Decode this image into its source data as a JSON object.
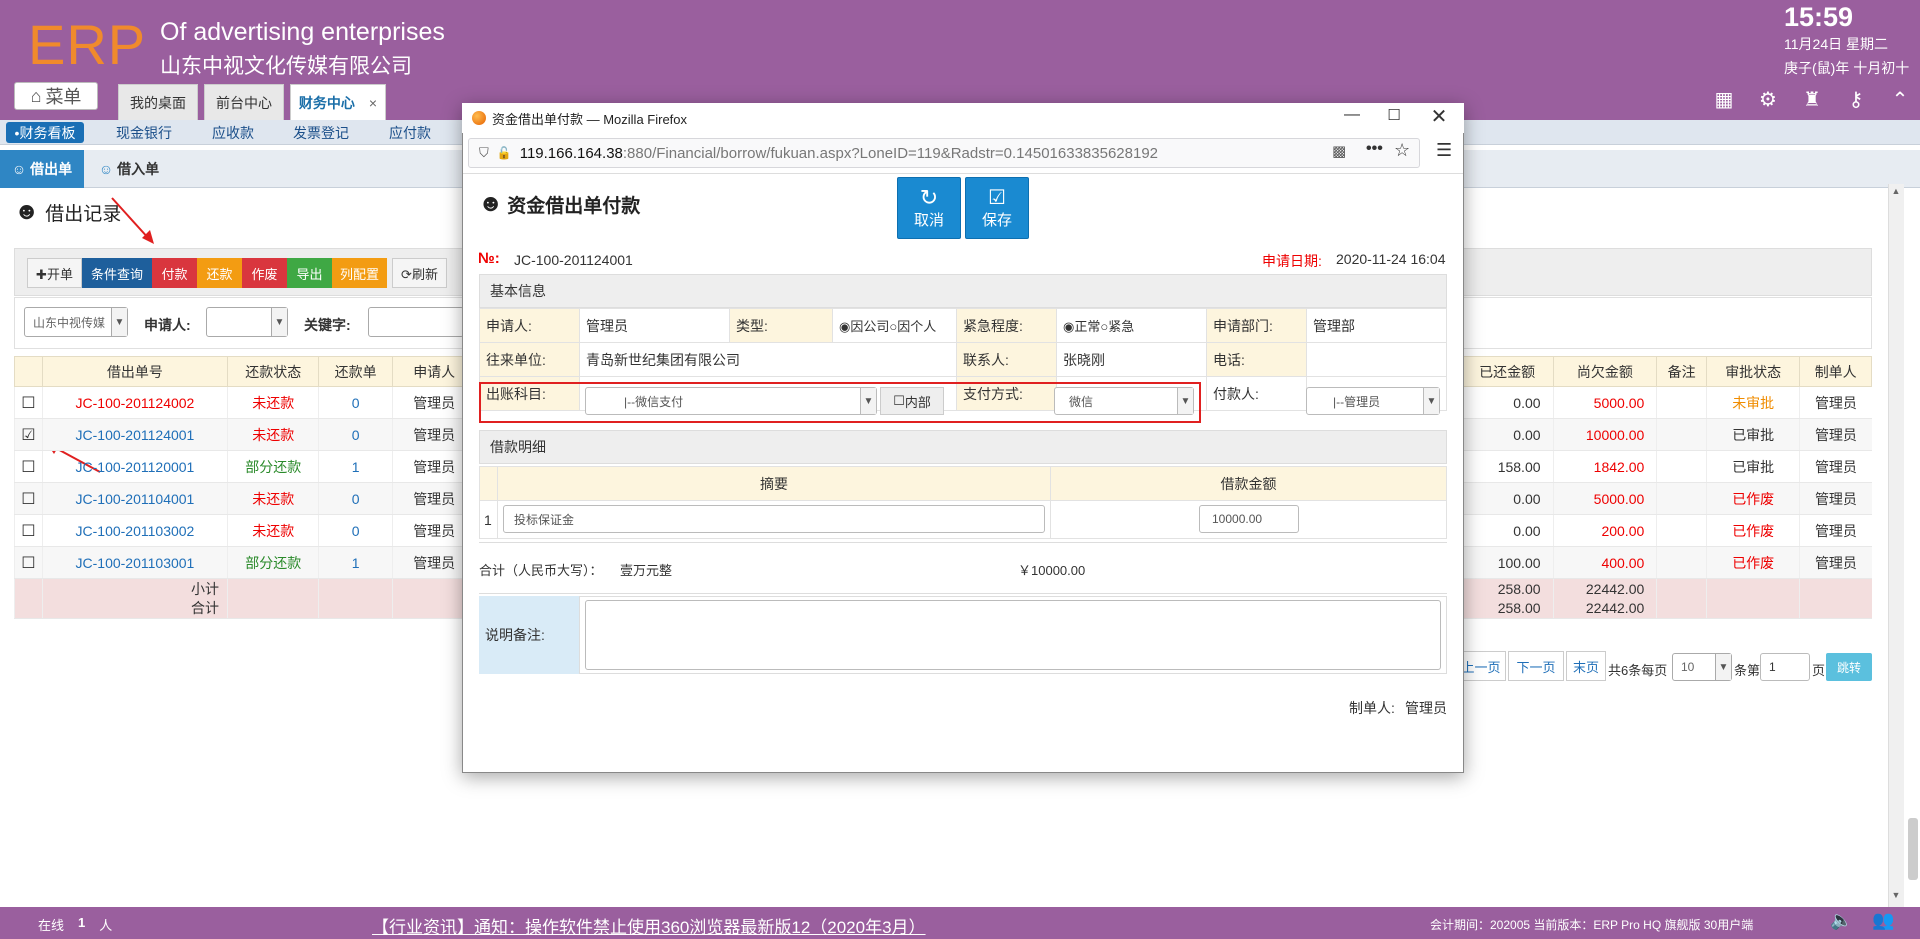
{
  "header": {
    "logo": "ERP",
    "company_en": "Of advertising enterprises",
    "company_cn": "山东中视文化传媒有限公司",
    "time": "15:59",
    "date": "11月24日 星期二",
    "lunar": "庚子(鼠)年 十月初十",
    "menu_label": "菜单",
    "tabs": [
      {
        "label": "我的桌面"
      },
      {
        "label": "前台中心"
      },
      {
        "label": "财务中心"
      }
    ],
    "tab_close": "×"
  },
  "subnav": [
    "•财务看板",
    "现金银行",
    "应收款",
    "发票登记",
    "应付款"
  ],
  "subtabs": [
    "借出单",
    "借入单"
  ],
  "page": {
    "title": "借出记录",
    "toolbar": [
      {
        "label": "✚开单",
        "color": "#f0f0f0"
      },
      {
        "label": "条件查询",
        "color": "#1e5f9c"
      },
      {
        "label": "付款",
        "color": "#d9363e"
      },
      {
        "label": "还款",
        "color": "#f39c12"
      },
      {
        "label": "作废",
        "color": "#d9363e"
      },
      {
        "label": "导出",
        "color": "#3fa844"
      },
      {
        "label": "列配置",
        "color": "#f39c12"
      },
      {
        "label": "⟳刷新",
        "color": "#f0f0f0"
      }
    ],
    "filter": {
      "company": "山东中视传媒",
      "applicant_label": "申请人:",
      "keyword_label": "关键字:"
    }
  },
  "table": {
    "headers": [
      "",
      "借出单号",
      "还款状态",
      "还款单",
      "申请人",
      "已还金额",
      "尚欠金额",
      "备注",
      "审批状态",
      "制单人"
    ],
    "rows": [
      {
        "checked": false,
        "no": "JC-100-201124002",
        "status": "未还款",
        "repay": "0",
        "applicant": "管理员",
        "paid": "0.00",
        "owed": "5000.00",
        "note": "",
        "approval": "未审批",
        "maker": "管理员"
      },
      {
        "checked": true,
        "no": "JC-100-201124001",
        "status": "未还款",
        "repay": "0",
        "applicant": "管理员",
        "paid": "0.00",
        "owed": "10000.00",
        "note": "",
        "approval": "已审批",
        "maker": "管理员"
      },
      {
        "checked": false,
        "no": "JC-100-201120001",
        "status": "部分还款",
        "repay": "1",
        "applicant": "管理员",
        "paid": "158.00",
        "owed": "1842.00",
        "note": "",
        "approval": "已审批",
        "maker": "管理员"
      },
      {
        "checked": false,
        "no": "JC-100-201104001",
        "status": "未还款",
        "repay": "0",
        "applicant": "管理员",
        "paid": "0.00",
        "owed": "5000.00",
        "note": "",
        "approval": "已作废",
        "maker": "管理员"
      },
      {
        "checked": false,
        "no": "JC-100-201103002",
        "status": "未还款",
        "repay": "0",
        "applicant": "管理员",
        "paid": "0.00",
        "owed": "200.00",
        "note": "",
        "approval": "已作废",
        "maker": "管理员"
      },
      {
        "checked": false,
        "no": "JC-100-201103001",
        "status": "部分还款",
        "repay": "1",
        "applicant": "管理员",
        "paid": "100.00",
        "owed": "400.00",
        "note": "",
        "approval": "已作废",
        "maker": "管理员"
      }
    ],
    "subtotal_label": "小计",
    "total_label": "合计",
    "subtotal_paid": "258.00",
    "subtotal_owed": "22442.00",
    "total_paid": "258.00",
    "total_owed": "22442.00"
  },
  "pagination": {
    "prev": "上一页",
    "next": "下一页",
    "last": "末页",
    "summary": "共6条每页",
    "per_page": "10",
    "per_page_suffix": "条第",
    "page": "1",
    "page_suffix": "页",
    "jump": "跳转"
  },
  "statusbar": {
    "online": "在线",
    "online_count": "1",
    "online_unit": "人",
    "news": "【行业资讯】通知：操作软件禁止使用360浏览器最新版12（2020年3月）",
    "period": "会计期间：202005 当前版本：ERP Pro HQ 旗舰版 30用户端"
  },
  "dialog": {
    "window_title": "资金借出单付款 — Mozilla Firefox",
    "url_host": "119.166.164.38",
    "url_rest": ":880/Financial/borrow/fukuan.aspx?LoneID=119&Radstr=0.14501633835628192",
    "heading": "资金借出单付款",
    "cancel": "取消",
    "save": "保存",
    "no_label": "№:",
    "no_value": "JC-100-201124001",
    "date_label": "申请日期:",
    "date_value": "2020-11-24 16:04",
    "basic_section": "基本信息",
    "applicant_label": "申请人:",
    "applicant": "管理员",
    "type_label": "类型:",
    "type_public": "因公司",
    "type_private": "因个人",
    "urgency_label": "紧急程度:",
    "urgency_normal": "正常",
    "urgency_urgent": "紧急",
    "dept_label": "申请部门:",
    "dept": "管理部",
    "partner_label": "往来单位:",
    "partner": "青岛新世纪集团有限公司",
    "contact_label": "联系人:",
    "contact": "张晓刚",
    "phone_label": "电话:",
    "account_label": "出账科目:",
    "account_value": "|--微信支付",
    "internal_label": "内部",
    "paymethod_label": "支付方式:",
    "paymethod_value": "微信",
    "payer_label": "付款人:",
    "payer_value": "|--管理员",
    "detail_section": "借款明细",
    "detail_headers": [
      "摘要",
      "借款金额"
    ],
    "detail_rows": [
      {
        "idx": "1",
        "summary": "投标保证金",
        "amount": "10000.00"
      }
    ],
    "total_label": "合计（人民币大写）：",
    "total_cn": "壹万元整",
    "total_num": "￥10000.00",
    "remark_label": "说明备注:",
    "maker_label": "制单人:",
    "maker": "管理员"
  }
}
